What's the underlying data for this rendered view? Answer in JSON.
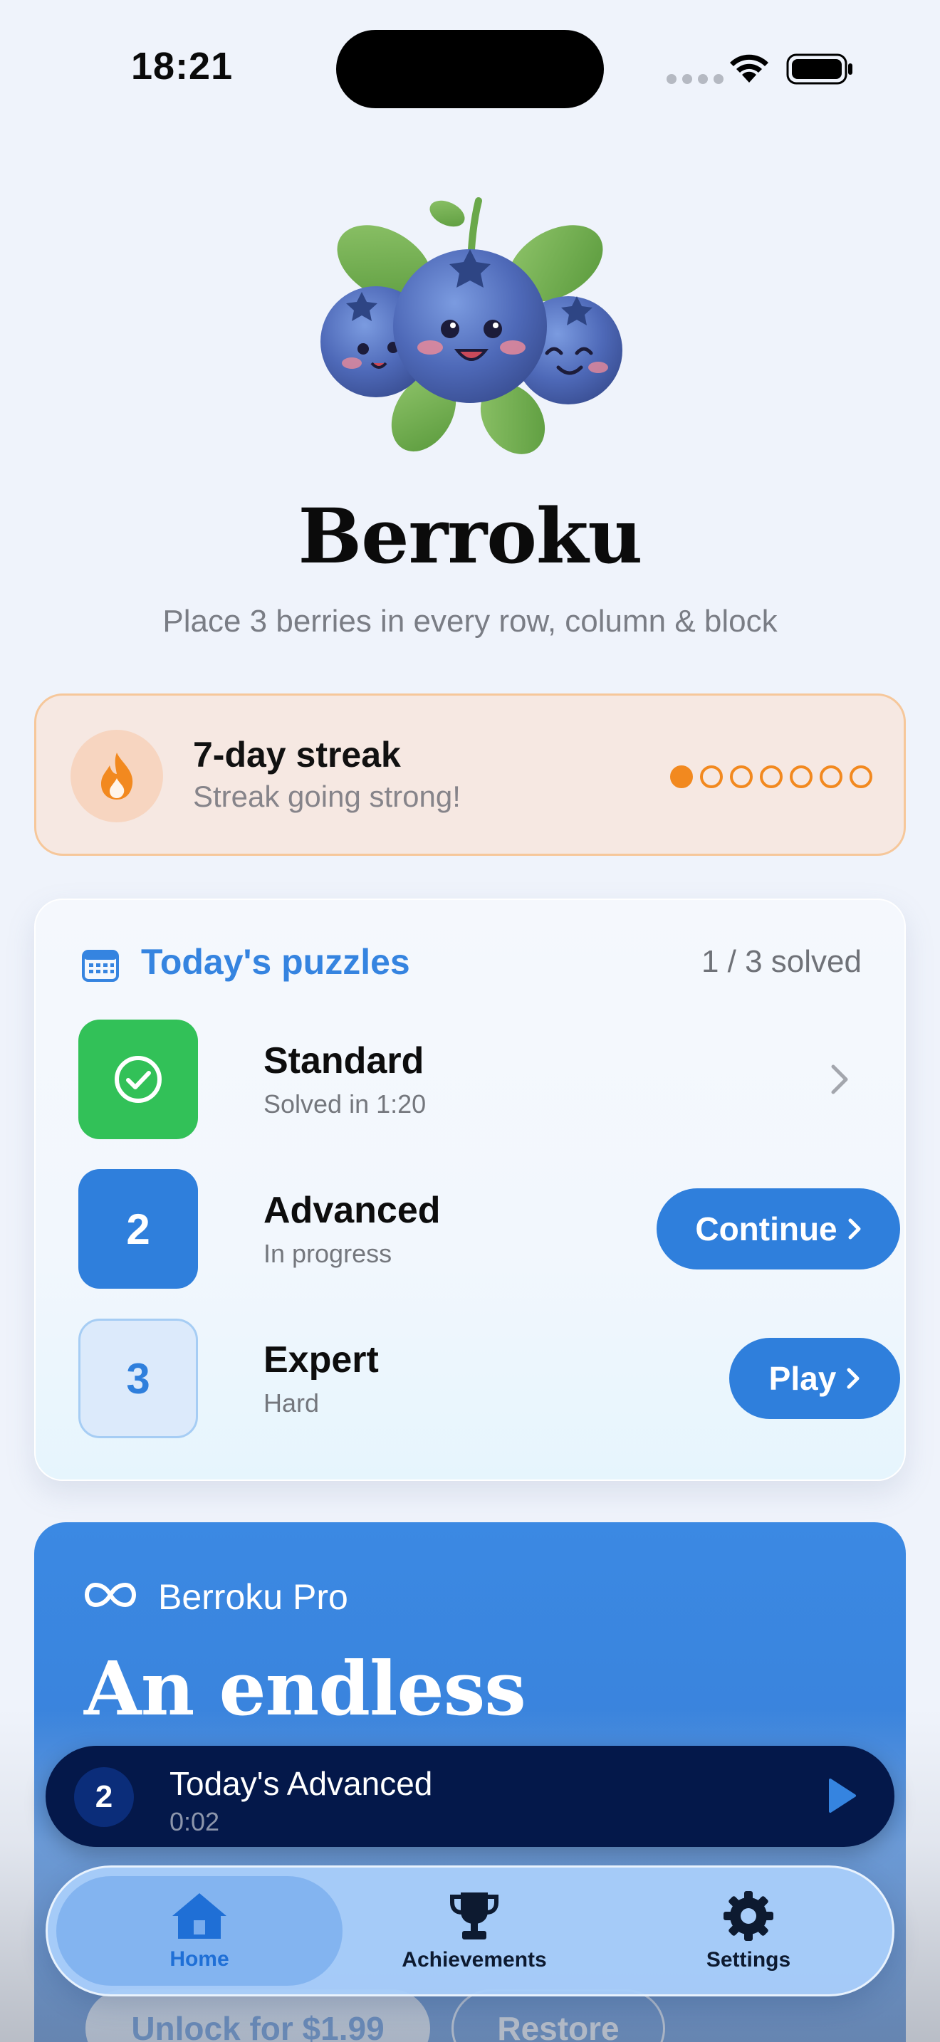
{
  "status_bar": {
    "time": "18:21"
  },
  "app": {
    "title": "Berroku",
    "subtitle": "Place 3 berries in every row, column & block"
  },
  "streak": {
    "title": "7-day streak",
    "subtitle": "Streak going strong!",
    "days_total": 7,
    "days_filled": 1,
    "accent": "#f2891f"
  },
  "puzzles": {
    "title": "Today's puzzles",
    "count": "1 / 3 solved",
    "items": [
      {
        "tile": "",
        "title": "Standard",
        "subtitle": "Solved in 1:20",
        "action": ""
      },
      {
        "tile": "2",
        "title": "Advanced",
        "subtitle": "In progress",
        "action": "Continue"
      },
      {
        "tile": "3",
        "title": "Expert",
        "subtitle": "Hard",
        "action": "Play"
      }
    ]
  },
  "pro": {
    "label": "Berroku Pro",
    "headline": "An endless",
    "unlock_label": "Unlock for $1.99",
    "restore_label": "Restore"
  },
  "now_playing": {
    "badge": "2",
    "title": "Today's Advanced",
    "time": "0:02"
  },
  "tabbar": {
    "items": [
      {
        "label": "Home",
        "icon": "home-icon",
        "active": true
      },
      {
        "label": "Achievements",
        "icon": "trophy-icon",
        "active": false
      },
      {
        "label": "Settings",
        "icon": "gear-icon",
        "active": false
      }
    ]
  },
  "colors": {
    "primary": "#2f7fdc",
    "success": "#32c158",
    "background": "#eff3fb"
  }
}
